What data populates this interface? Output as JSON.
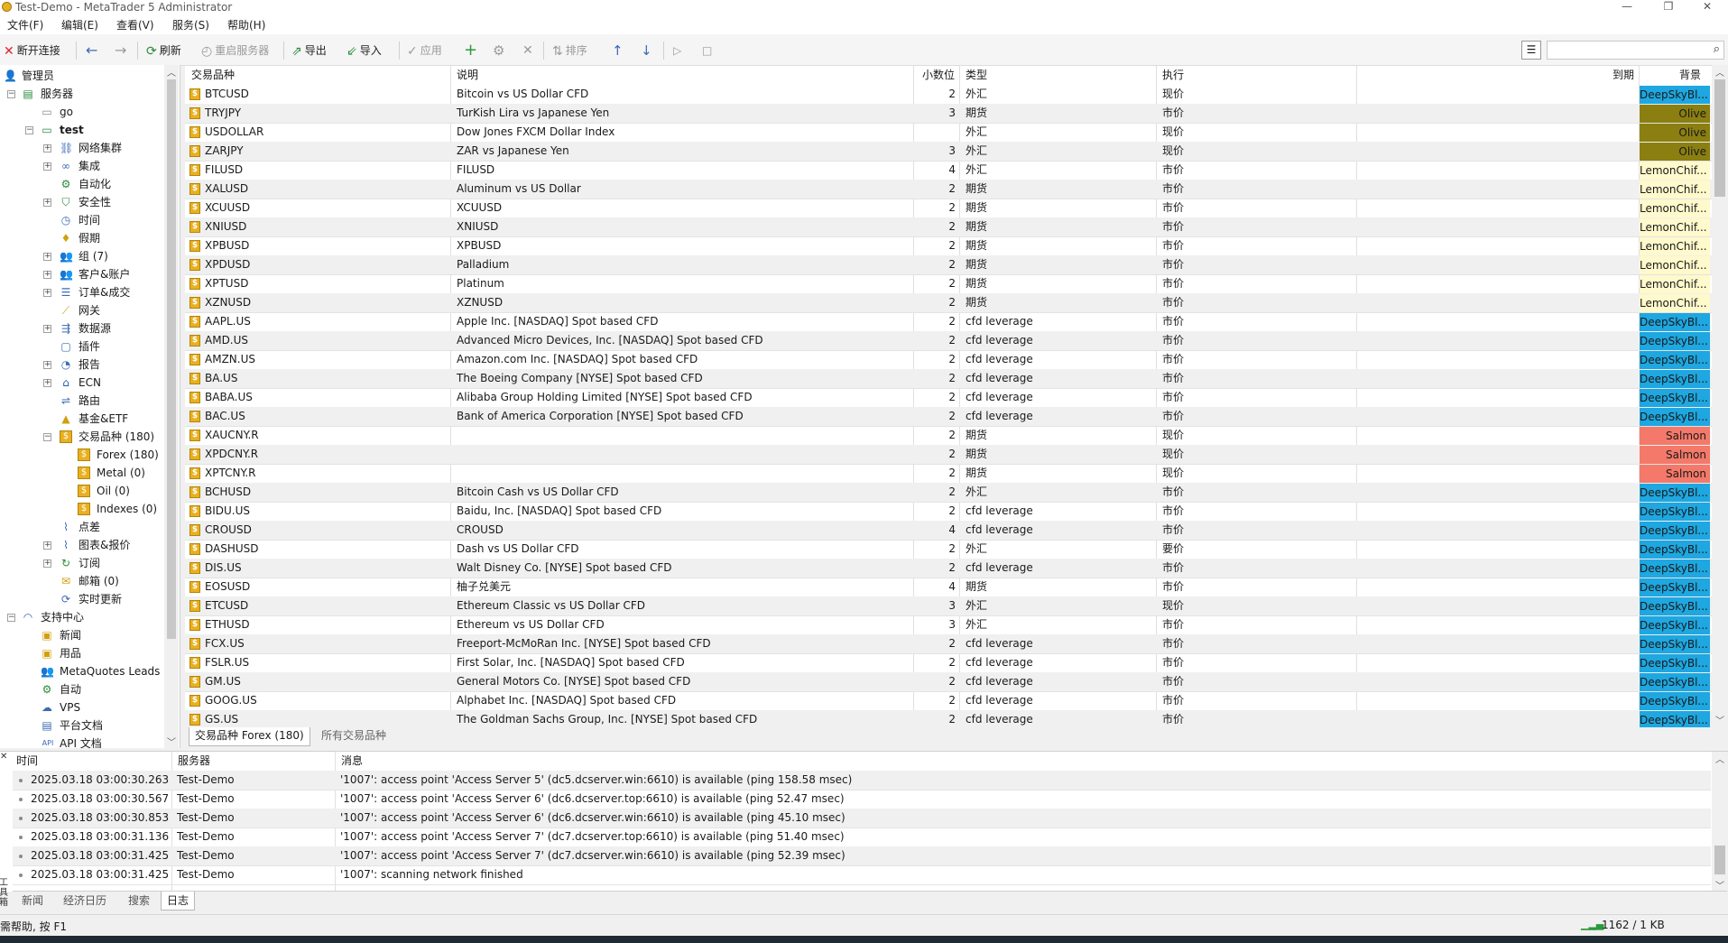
{
  "window": {
    "title": "Test-Demo - MetaTrader 5 Administrator",
    "minimize": "—",
    "maximize": "❐",
    "close": "✕"
  },
  "menu": [
    "文件(F)",
    "编辑(E)",
    "查看(V)",
    "服务(S)",
    "帮助(H)"
  ],
  "toolbar": {
    "disconnect": "断开连接",
    "refresh": "刷新",
    "restart": "重启服务器",
    "export": "导出",
    "import": "导入",
    "apply": "应用",
    "sort": "排序"
  },
  "search": {
    "placeholder": ""
  },
  "navigator": [
    {
      "label": "管理员",
      "icon": "admin-icon"
    },
    {
      "label": "服务器",
      "icon": "servers-icon"
    },
    {
      "label": "go",
      "icon": "server-icon"
    },
    {
      "label": "test",
      "icon": "server-icon"
    },
    {
      "label": "网络集群",
      "icon": "network-icon"
    },
    {
      "label": "集成",
      "icon": "integration-icon"
    },
    {
      "label": "自动化",
      "icon": "automation-icon"
    },
    {
      "label": "安全性",
      "icon": "shield-icon"
    },
    {
      "label": "时间",
      "icon": "clock-icon"
    },
    {
      "label": "假期",
      "icon": "holiday-icon"
    },
    {
      "label": "组 (7)",
      "icon": "group-icon"
    },
    {
      "label": "客户&账户",
      "icon": "clients-icon"
    },
    {
      "label": "订单&成交",
      "icon": "orders-icon"
    },
    {
      "label": "网关",
      "icon": "gateway-icon"
    },
    {
      "label": "数据源",
      "icon": "datafeed-icon"
    },
    {
      "label": "插件",
      "icon": "plugin-icon"
    },
    {
      "label": "报告",
      "icon": "report-icon"
    },
    {
      "label": "ECN",
      "icon": "ecn-icon"
    },
    {
      "label": "路由",
      "icon": "routing-icon"
    },
    {
      "label": "基金&ETF",
      "icon": "fund-icon"
    },
    {
      "label": "交易品种 (180)",
      "icon": "symbols-icon"
    },
    {
      "label": "Forex (180)",
      "icon": "symbol-folder-icon"
    },
    {
      "label": "Metal (0)",
      "icon": "symbol-folder-icon"
    },
    {
      "label": "Oil (0)",
      "icon": "symbol-folder-icon"
    },
    {
      "label": "Indexes (0)",
      "icon": "symbol-folder-icon"
    },
    {
      "label": "点差",
      "icon": "spread-icon"
    },
    {
      "label": "图表&报价",
      "icon": "chart-icon"
    },
    {
      "label": "订阅",
      "icon": "subscription-icon"
    },
    {
      "label": "邮箱 (0)",
      "icon": "mail-icon"
    },
    {
      "label": "实时更新",
      "icon": "liveupdate-icon"
    },
    {
      "label": "支持中心",
      "icon": "support-icon"
    },
    {
      "label": "新闻",
      "icon": "news-icon"
    },
    {
      "label": "用品",
      "icon": "supplies-icon"
    },
    {
      "label": "MetaQuotes Leads",
      "icon": "leads-icon"
    },
    {
      "label": "自动",
      "icon": "auto-icon"
    },
    {
      "label": "VPS",
      "icon": "vps-icon"
    },
    {
      "label": "平台文档",
      "icon": "docs-icon"
    },
    {
      "label": "API 文档",
      "icon": "api-icon"
    }
  ],
  "grid": {
    "headers": {
      "symbol": "交易品种",
      "desc": "说明",
      "digits": "小数位",
      "type": "类型",
      "exec": "执行",
      "expiry": "到期",
      "bg": "背景"
    },
    "rows": [
      {
        "symbol": "BTCUSD",
        "desc": "Bitcoin vs US Dollar CFD",
        "digits": "2",
        "type": "外汇",
        "exec": "现价",
        "bg": "DeepSkyBl...",
        "color": "#1ea7e0"
      },
      {
        "symbol": "TRYJPY",
        "desc": "TurKish Lira vs Japanese Yen",
        "digits": "3",
        "type": "期货",
        "exec": "市价",
        "bg": "Olive",
        "color": "#8a7f10"
      },
      {
        "symbol": "USDOLLAR",
        "desc": "Dow Jones FXCM Dollar Index",
        "digits": "",
        "type": "外汇",
        "exec": "现价",
        "bg": "Olive",
        "color": "#8a7f10"
      },
      {
        "symbol": "ZARJPY",
        "desc": "ZAR vs Japanese Yen",
        "digits": "3",
        "type": "外汇",
        "exec": "现价",
        "bg": "Olive",
        "color": "#8a7f10"
      },
      {
        "symbol": "FILUSD",
        "desc": "FILUSD",
        "digits": "4",
        "type": "外汇",
        "exec": "市价",
        "bg": "LemonChif...",
        "color": "#fff9cc"
      },
      {
        "symbol": "XALUSD",
        "desc": "Aluminum vs US Dollar",
        "digits": "2",
        "type": "期货",
        "exec": "市价",
        "bg": "LemonChif...",
        "color": "#fff9cc"
      },
      {
        "symbol": "XCUUSD",
        "desc": "XCUUSD",
        "digits": "2",
        "type": "期货",
        "exec": "市价",
        "bg": "LemonChif...",
        "color": "#fff9cc"
      },
      {
        "symbol": "XNIUSD",
        "desc": "XNIUSD",
        "digits": "2",
        "type": "期货",
        "exec": "市价",
        "bg": "LemonChif...",
        "color": "#fff9cc"
      },
      {
        "symbol": "XPBUSD",
        "desc": "XPBUSD",
        "digits": "2",
        "type": "期货",
        "exec": "市价",
        "bg": "LemonChif...",
        "color": "#fff9cc"
      },
      {
        "symbol": "XPDUSD",
        "desc": "Palladium",
        "digits": "2",
        "type": "期货",
        "exec": "市价",
        "bg": "LemonChif...",
        "color": "#fff9cc"
      },
      {
        "symbol": "XPTUSD",
        "desc": "Platinum",
        "digits": "2",
        "type": "期货",
        "exec": "市价",
        "bg": "LemonChif...",
        "color": "#fff9cc"
      },
      {
        "symbol": "XZNUSD",
        "desc": "XZNUSD",
        "digits": "2",
        "type": "期货",
        "exec": "市价",
        "bg": "LemonChif...",
        "color": "#fff9cc"
      },
      {
        "symbol": "AAPL.US",
        "desc": "Apple Inc. [NASDAQ] Spot based CFD",
        "digits": "2",
        "type": "cfd leverage",
        "exec": "市价",
        "bg": "DeepSkyBl...",
        "color": "#1ea7e0"
      },
      {
        "symbol": "AMD.US",
        "desc": "Advanced Micro Devices, Inc. [NASDAQ] Spot based CFD",
        "digits": "2",
        "type": "cfd leverage",
        "exec": "市价",
        "bg": "DeepSkyBl...",
        "color": "#1ea7e0"
      },
      {
        "symbol": "AMZN.US",
        "desc": "Amazon.com Inc. [NASDAQ] Spot based CFD",
        "digits": "2",
        "type": "cfd leverage",
        "exec": "市价",
        "bg": "DeepSkyBl...",
        "color": "#1ea7e0"
      },
      {
        "symbol": "BA.US",
        "desc": "The Boeing Company [NYSE] Spot based CFD",
        "digits": "2",
        "type": "cfd leverage",
        "exec": "市价",
        "bg": "DeepSkyBl...",
        "color": "#1ea7e0"
      },
      {
        "symbol": "BABA.US",
        "desc": "Alibaba Group Holding Limited [NYSE] Spot based CFD",
        "digits": "2",
        "type": "cfd leverage",
        "exec": "市价",
        "bg": "DeepSkyBl...",
        "color": "#1ea7e0"
      },
      {
        "symbol": "BAC.US",
        "desc": "Bank of America Corporation [NYSE] Spot based CFD",
        "digits": "2",
        "type": "cfd leverage",
        "exec": "市价",
        "bg": "DeepSkyBl...",
        "color": "#1ea7e0"
      },
      {
        "symbol": "XAUCNY.R",
        "desc": "",
        "digits": "2",
        "type": "期货",
        "exec": "现价",
        "bg": "Salmon",
        "color": "#f4796a"
      },
      {
        "symbol": "XPDCNY.R",
        "desc": "",
        "digits": "2",
        "type": "期货",
        "exec": "现价",
        "bg": "Salmon",
        "color": "#f4796a"
      },
      {
        "symbol": "XPTCNY.R",
        "desc": "",
        "digits": "2",
        "type": "期货",
        "exec": "现价",
        "bg": "Salmon",
        "color": "#f4796a"
      },
      {
        "symbol": "BCHUSD",
        "desc": "Bitcoin Cash vs US Dollar CFD",
        "digits": "2",
        "type": "外汇",
        "exec": "市价",
        "bg": "DeepSkyBl...",
        "color": "#1ea7e0"
      },
      {
        "symbol": "BIDU.US",
        "desc": "Baidu, Inc. [NASDAQ] Spot based CFD",
        "digits": "2",
        "type": "cfd leverage",
        "exec": "市价",
        "bg": "DeepSkyBl...",
        "color": "#1ea7e0"
      },
      {
        "symbol": "CROUSD",
        "desc": "CROUSD",
        "digits": "4",
        "type": "cfd leverage",
        "exec": "市价",
        "bg": "DeepSkyBl...",
        "color": "#1ea7e0"
      },
      {
        "symbol": "DASHUSD",
        "desc": "Dash vs US Dollar CFD",
        "digits": "2",
        "type": "外汇",
        "exec": "要价",
        "bg": "DeepSkyBl...",
        "color": "#1ea7e0"
      },
      {
        "symbol": "DIS.US",
        "desc": "Walt Disney Co. [NYSE] Spot based CFD",
        "digits": "2",
        "type": "cfd leverage",
        "exec": "市价",
        "bg": "DeepSkyBl...",
        "color": "#1ea7e0"
      },
      {
        "symbol": "EOSUSD",
        "desc": "柚子兑美元",
        "digits": "4",
        "type": "期货",
        "exec": "市价",
        "bg": "DeepSkyBl...",
        "color": "#1ea7e0"
      },
      {
        "symbol": "ETCUSD",
        "desc": "Ethereum Classic vs US Dollar CFD",
        "digits": "3",
        "type": "外汇",
        "exec": "现价",
        "bg": "DeepSkyBl...",
        "color": "#1ea7e0"
      },
      {
        "symbol": "ETHUSD",
        "desc": "Ethereum vs US Dollar CFD",
        "digits": "3",
        "type": "外汇",
        "exec": "市价",
        "bg": "DeepSkyBl...",
        "color": "#1ea7e0"
      },
      {
        "symbol": "FCX.US",
        "desc": "Freeport-McMoRan Inc. [NYSE] Spot based CFD",
        "digits": "2",
        "type": "cfd leverage",
        "exec": "市价",
        "bg": "DeepSkyBl...",
        "color": "#1ea7e0"
      },
      {
        "symbol": "FSLR.US",
        "desc": "First Solar, Inc. [NASDAQ] Spot based CFD",
        "digits": "2",
        "type": "cfd leverage",
        "exec": "市价",
        "bg": "DeepSkyBl...",
        "color": "#1ea7e0"
      },
      {
        "symbol": "GM.US",
        "desc": "General Motors Co. [NYSE] Spot based CFD",
        "digits": "2",
        "type": "cfd leverage",
        "exec": "市价",
        "bg": "DeepSkyBl...",
        "color": "#1ea7e0"
      },
      {
        "symbol": "GOOG.US",
        "desc": "Alphabet Inc. [NASDAQ] Spot based CFD",
        "digits": "2",
        "type": "cfd leverage",
        "exec": "市价",
        "bg": "DeepSkyBl...",
        "color": "#1ea7e0"
      },
      {
        "symbol": "GS.US",
        "desc": "The Goldman Sachs Group, Inc. [NYSE] Spot based CFD",
        "digits": "2",
        "type": "cfd leverage",
        "exec": "市价",
        "bg": "DeepSkyBl...",
        "color": "#1ea7e0"
      }
    ]
  },
  "grid_tabs": [
    "交易品种 Forex (180)",
    "所有交易品种"
  ],
  "journal": {
    "headers": {
      "time": "时间",
      "server": "服务器",
      "message": "消息"
    },
    "rows": [
      {
        "time": "2025.03.18 03:00:30.263",
        "server": "Test-Demo",
        "message": "'1007': access point 'Access Server 5' (dc5.dcserver.win:6610) is available (ping 158.58 msec)"
      },
      {
        "time": "2025.03.18 03:00:30.567",
        "server": "Test-Demo",
        "message": "'1007': access point 'Access Server 6' (dc6.dcserver.top:6610) is available (ping 52.47 msec)"
      },
      {
        "time": "2025.03.18 03:00:30.853",
        "server": "Test-Demo",
        "message": "'1007': access point 'Access Server 6' (dc6.dcserver.win:6610) is available (ping 45.10 msec)"
      },
      {
        "time": "2025.03.18 03:00:31.136",
        "server": "Test-Demo",
        "message": "'1007': access point 'Access Server 7' (dc7.dcserver.top:6610) is available (ping 51.40 msec)"
      },
      {
        "time": "2025.03.18 03:00:31.425",
        "server": "Test-Demo",
        "message": "'1007': access point 'Access Server 7' (dc7.dcserver.win:6610) is available (ping 52.39 msec)"
      },
      {
        "time": "2025.03.18 03:00:31.425",
        "server": "Test-Demo",
        "message": "'1007': scanning network finished"
      }
    ]
  },
  "journal_tabs": [
    "新闻",
    "经济日历",
    "搜索",
    "日志"
  ],
  "journal_side_label": "工具箱",
  "status": {
    "help": "需帮助, 按 F1",
    "traffic": "1162 / 1 KB"
  }
}
